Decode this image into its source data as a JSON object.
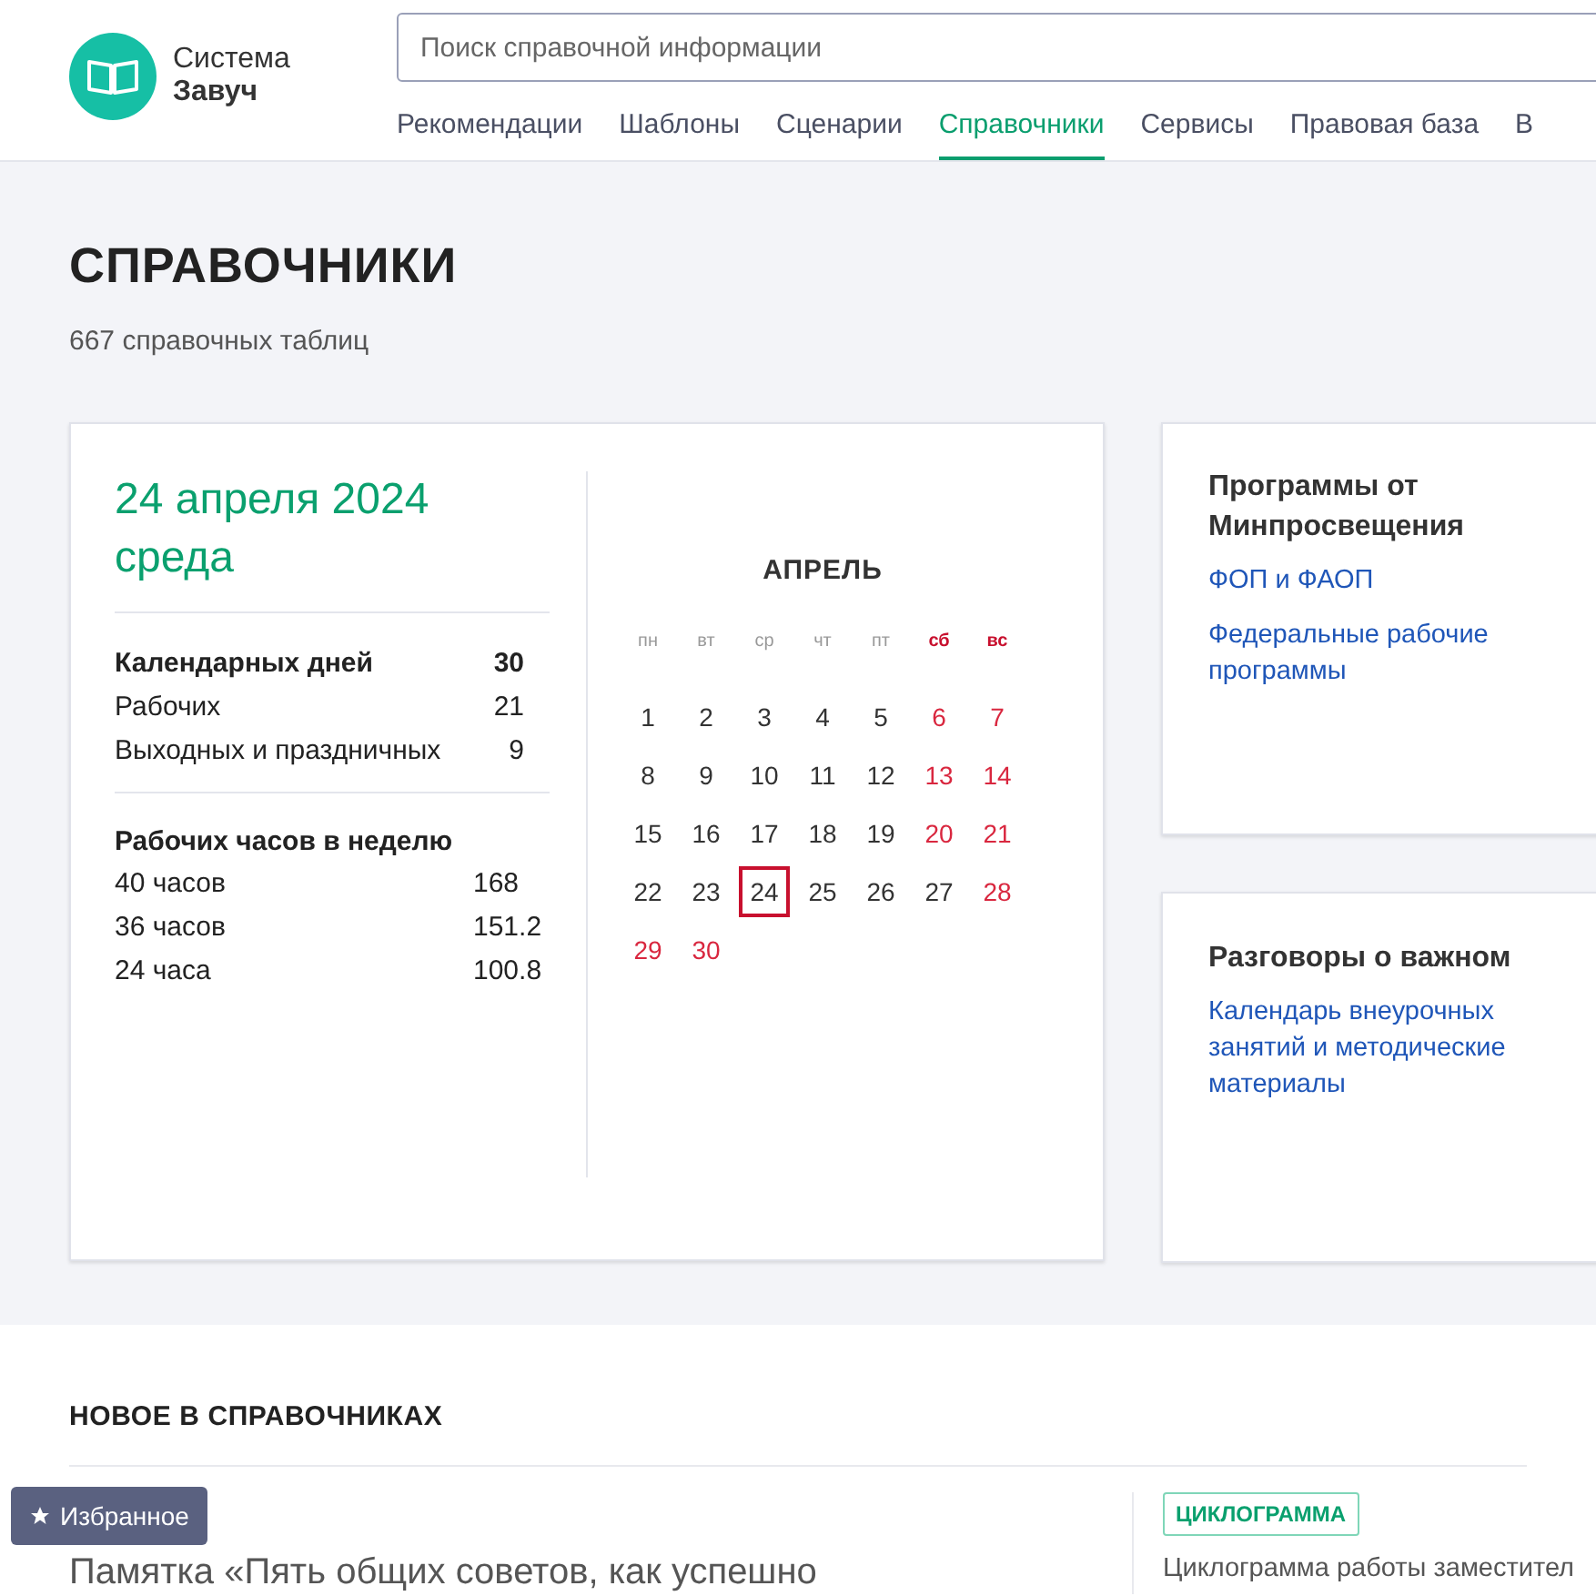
{
  "logo": {
    "line1": "Система",
    "line2": "Завуч"
  },
  "search": {
    "placeholder": "Поиск справочной информации"
  },
  "nav": [
    {
      "label": "Рекомендации",
      "selected": false
    },
    {
      "label": "Шаблоны",
      "selected": false
    },
    {
      "label": "Сценарии",
      "selected": false
    },
    {
      "label": "Справочники",
      "selected": true
    },
    {
      "label": "Сервисы",
      "selected": false
    },
    {
      "label": "Правовая база",
      "selected": false
    },
    {
      "label": "В",
      "selected": false
    }
  ],
  "page": {
    "title": "СПРАВОЧНИКИ",
    "subtitle": "667 справочных таблиц"
  },
  "date_card": {
    "date": "24 апреля 2024",
    "weekday": "среда",
    "days": {
      "rows": [
        {
          "label": "Календарных дней",
          "value": "30",
          "bold": true
        },
        {
          "label": "Рабочих",
          "value": "21",
          "bold": false
        },
        {
          "label": "Выходных и праздничных",
          "value": "9",
          "bold": false
        }
      ]
    },
    "hours": {
      "title": "Рабочих часов в неделю",
      "rows": [
        {
          "label": "40 часов",
          "value": "168"
        },
        {
          "label": "36 часов",
          "value": "151.2"
        },
        {
          "label": "24 часа",
          "value": "100.8"
        }
      ]
    },
    "calendar": {
      "month": "АПРЕЛЬ",
      "weekdays": [
        {
          "label": "пн",
          "weekend": false
        },
        {
          "label": "вт",
          "weekend": false
        },
        {
          "label": "ср",
          "weekend": false
        },
        {
          "label": "чт",
          "weekend": false
        },
        {
          "label": "пт",
          "weekend": false
        },
        {
          "label": "сб",
          "weekend": true
        },
        {
          "label": "вс",
          "weekend": true
        }
      ],
      "weeks": [
        [
          {
            "day": "1",
            "weekend": false,
            "selected": false
          },
          {
            "day": "2",
            "weekend": false,
            "selected": false
          },
          {
            "day": "3",
            "weekend": false,
            "selected": false
          },
          {
            "day": "4",
            "weekend": false,
            "selected": false
          },
          {
            "day": "5",
            "weekend": false,
            "selected": false
          },
          {
            "day": "6",
            "weekend": true,
            "selected": false
          },
          {
            "day": "7",
            "weekend": true,
            "selected": false
          }
        ],
        [
          {
            "day": "8",
            "weekend": false,
            "selected": false
          },
          {
            "day": "9",
            "weekend": false,
            "selected": false
          },
          {
            "day": "10",
            "weekend": false,
            "selected": false
          },
          {
            "day": "11",
            "weekend": false,
            "selected": false
          },
          {
            "day": "12",
            "weekend": false,
            "selected": false
          },
          {
            "day": "13",
            "weekend": true,
            "selected": false
          },
          {
            "day": "14",
            "weekend": true,
            "selected": false
          }
        ],
        [
          {
            "day": "15",
            "weekend": false,
            "selected": false
          },
          {
            "day": "16",
            "weekend": false,
            "selected": false
          },
          {
            "day": "17",
            "weekend": false,
            "selected": false
          },
          {
            "day": "18",
            "weekend": false,
            "selected": false
          },
          {
            "day": "19",
            "weekend": false,
            "selected": false
          },
          {
            "day": "20",
            "weekend": true,
            "selected": false
          },
          {
            "day": "21",
            "weekend": true,
            "selected": false
          }
        ],
        [
          {
            "day": "22",
            "weekend": false,
            "selected": false
          },
          {
            "day": "23",
            "weekend": false,
            "selected": false
          },
          {
            "day": "24",
            "weekend": false,
            "selected": true
          },
          {
            "day": "25",
            "weekend": false,
            "selected": false
          },
          {
            "day": "26",
            "weekend": false,
            "selected": false
          },
          {
            "day": "27",
            "weekend": false,
            "selected": false
          },
          {
            "day": "28",
            "weekend": true,
            "selected": false
          }
        ],
        [
          {
            "day": "29",
            "weekend": true,
            "selected": false
          },
          {
            "day": "30",
            "weekend": true,
            "selected": false
          }
        ]
      ]
    }
  },
  "side_cards": [
    {
      "title": "Программы от Минпросвещения",
      "links": [
        "ФОП и ФАОП",
        "Федеральные рабочие программы"
      ]
    },
    {
      "title": "Разговоры о важном",
      "links": [
        "Календарь внеурочных занятий и методические материалы"
      ]
    }
  ],
  "news": {
    "title": "НОВОЕ В СПРАВОЧНИКАХ",
    "items": [
      {
        "title": "Памятка «Пять общих советов, как успешно"
      },
      {
        "tag": "ЦИКЛОГРАММА",
        "title": "Циклограмма работы заместител"
      }
    ]
  },
  "favorites_button": {
    "label": "Избранное"
  }
}
